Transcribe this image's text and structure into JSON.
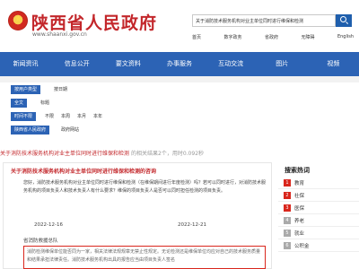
{
  "header": {
    "site_title": "陕西省人民政府",
    "site_domain": "www.shaanxi.gov.cn",
    "search_value": "关于消防技术服务机构对业主单位同时进行维保和检测",
    "top_links": [
      "首页",
      "数字政务",
      "省政府",
      "无障碍",
      "English"
    ]
  },
  "nav": {
    "items": [
      "新闻资讯",
      "信息公开",
      "要文资料",
      "办事服务",
      "互动交流",
      "图片",
      "视频"
    ]
  },
  "filters": {
    "rows": [
      {
        "tag": "按用户类型",
        "options": [
          "按日期"
        ]
      },
      {
        "tag": "全文",
        "options": [
          "标题"
        ]
      },
      {
        "tag": "时间不限",
        "options": [
          "不限",
          "本周",
          "本月",
          "本年"
        ]
      },
      {
        "tag": "陕西省人民政府",
        "options": [
          "政府网站"
        ]
      }
    ]
  },
  "result": {
    "headline": "关于消防技术服务机构对业主单位同时进行维保和检测",
    "stat": "的相关结果2个，用时0.092秒"
  },
  "card": {
    "title": "关于消防技术服务机构对业主单位同时进行维保和检测的咨询",
    "body": "您好，消防技术服务机构对业主单位同时进行维保和检测（在维保期间进行年度检测）吗？若可以同时进行，对消防技术服务机构的项目负责人和技术负责人有什么要求？维保的项目负责人是否可以同时担任检测的项目负责。",
    "date_label_1": "2022-12-16",
    "date_label_2": "2022-12-21",
    "source": "省消防救援总队",
    "answer": "消防检测维保单位能否同为一家，相关法律法规规章无禁止性规定。无论检测还是维保单位均应对自己的技术服务质量和结果承担法律责任。消防技术服务机构出具的报告应当由项目负责人签名"
  },
  "sidebar": {
    "title": "搜索热词",
    "items": [
      {
        "num": "1",
        "text": "教育"
      },
      {
        "num": "2",
        "text": "社保"
      },
      {
        "num": "3",
        "text": "医保"
      },
      {
        "num": "4",
        "text": "养老"
      },
      {
        "num": "5",
        "text": "就业"
      },
      {
        "num": "6",
        "text": "公积金"
      }
    ]
  }
}
